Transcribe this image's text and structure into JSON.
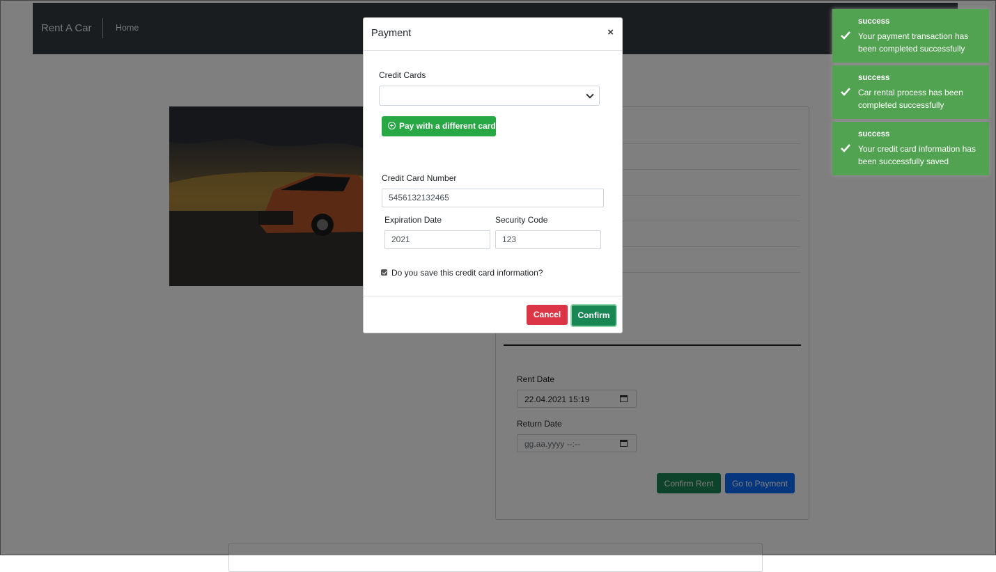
{
  "navbar": {
    "brand": "Rent A Car",
    "home": "Home"
  },
  "rent_form": {
    "rent_date_label": "Rent Date",
    "rent_date_value": "22.04.2021 15:19",
    "return_date_label": "Return Date",
    "return_date_placeholder": "gg.aa.yyyy --:--",
    "confirm_rent": "Confirm Rent",
    "go_to_payment": "Go to Payment"
  },
  "modal": {
    "title": "Payment",
    "close": "×",
    "credit_cards_label": "Credit Cards",
    "credit_cards_selected": "",
    "pay_different": "Pay with a different card",
    "card_number_label": "Credit Card Number",
    "card_number": "5456132132465",
    "expiration_label": "Expiration Date",
    "expiration": "2021",
    "security_label": "Security Code",
    "security": "123",
    "save_label": "Do you save this credit card information?",
    "save_checked": true,
    "cancel": "Cancel",
    "confirm": "Confirm"
  },
  "toasts": [
    {
      "title": "success",
      "message": "Your payment transaction has been completed successfully"
    },
    {
      "title": "success",
      "message": "Car rental process has been completed successfully"
    },
    {
      "title": "success",
      "message": "Your credit card information has been successfully saved"
    }
  ],
  "colors": {
    "navbar": "#343a40",
    "toast": "#51a351",
    "paydiff": "#28a745",
    "cancel": "#dc3545",
    "confirm": "#198754",
    "payment_btn": "#0d6efd"
  }
}
